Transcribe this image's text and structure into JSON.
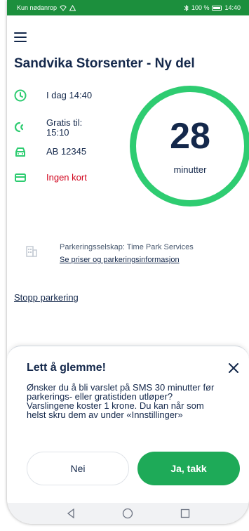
{
  "status_bar": {
    "left_text": "Kun nødanrop",
    "right_text": "100 %",
    "time": "14:40"
  },
  "header": {
    "title": "Sandvika Storsenter - Ny del"
  },
  "parking": {
    "start_time": "I dag 14:40",
    "free_until_label": "Gratis til:",
    "free_until_time": "15:10",
    "plate": "AB 12345",
    "card": "Ingen kort",
    "remaining_value": "28",
    "remaining_unit": "minutter",
    "company": "Parkeringsselskap: Time Park Services",
    "prices_link": "Se priser og parkeringsinformasjon",
    "stop_link": "Stopp parkering"
  },
  "dialog": {
    "title": "Lett å glemme!",
    "body": "Ønsker du å bli varslet på SMS 30 minutter før parkerings- eller gratistiden utløper? Varslingene koster 1 krone. Du kan når som helst skru dem av under «Innstillinger»",
    "no_label": "Nei",
    "yes_label": "Ja, takk"
  },
  "colors": {
    "brand_green": "#1c8f3d",
    "accent_green": "#2ecc71",
    "button_green": "#1eaa58",
    "text_navy": "#14284b",
    "warning_red": "#d0021b"
  },
  "icons": {
    "clock": "clock-icon",
    "free": "free-time-icon",
    "car": "car-icon",
    "card": "credit-card-icon",
    "building": "building-icon",
    "close": "close-icon",
    "menu": "hamburger-menu-icon"
  }
}
